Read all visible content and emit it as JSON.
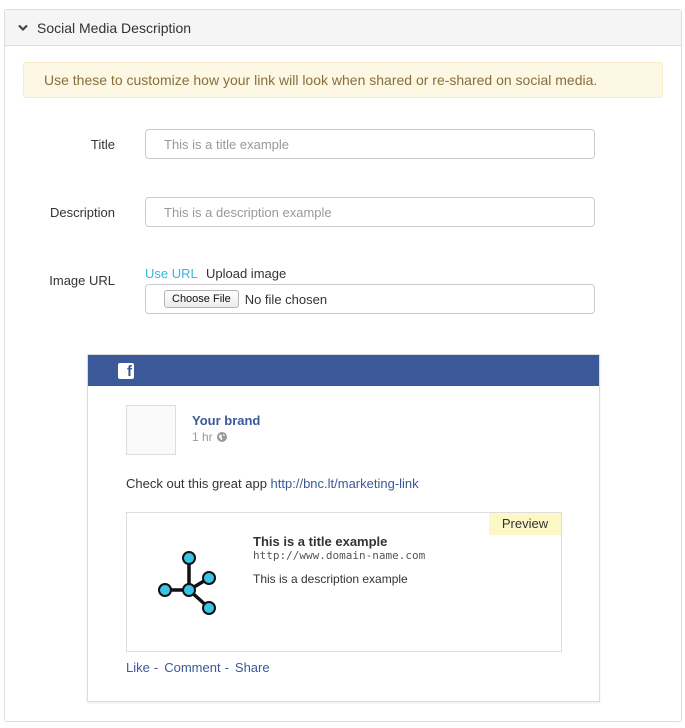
{
  "panel": {
    "title": "Social Media Description",
    "toggle_icon": "chevron-down-icon"
  },
  "notice": {
    "text": "Use these to customize how your link will look when shared or re-shared on social media."
  },
  "form": {
    "title": {
      "label": "Title",
      "value": "",
      "placeholder": "This is a title example"
    },
    "description": {
      "label": "Description",
      "value": "",
      "placeholder": "This is a description example"
    },
    "image": {
      "label": "Image URL",
      "tab_use_url": "Use URL",
      "tab_upload": "Upload image",
      "choose_button": "Choose File",
      "file_status": "No file chosen"
    }
  },
  "preview_card": {
    "network_icon": "facebook-icon",
    "brand": "Your brand",
    "time": "1 hr",
    "post_text": "Check out this great app",
    "post_link": "http://bnc.lt/marketing-link",
    "link_box": {
      "badge": "Preview",
      "title": "This is a title example",
      "url": "http://www.domain-name.com",
      "description": "This is a description example",
      "icon": "share-graph-icon"
    },
    "actions": {
      "like": "Like",
      "comment": "Comment",
      "share": "Share",
      "separator": "-"
    }
  },
  "colors": {
    "facebook_blue": "#3b5998",
    "tab_active": "#3bb4d9",
    "notice_bg": "#fcf8e3",
    "notice_text": "#8a6d3b",
    "preview_badge_bg": "#fcf8c6",
    "node_fill": "#3bc4e5"
  }
}
